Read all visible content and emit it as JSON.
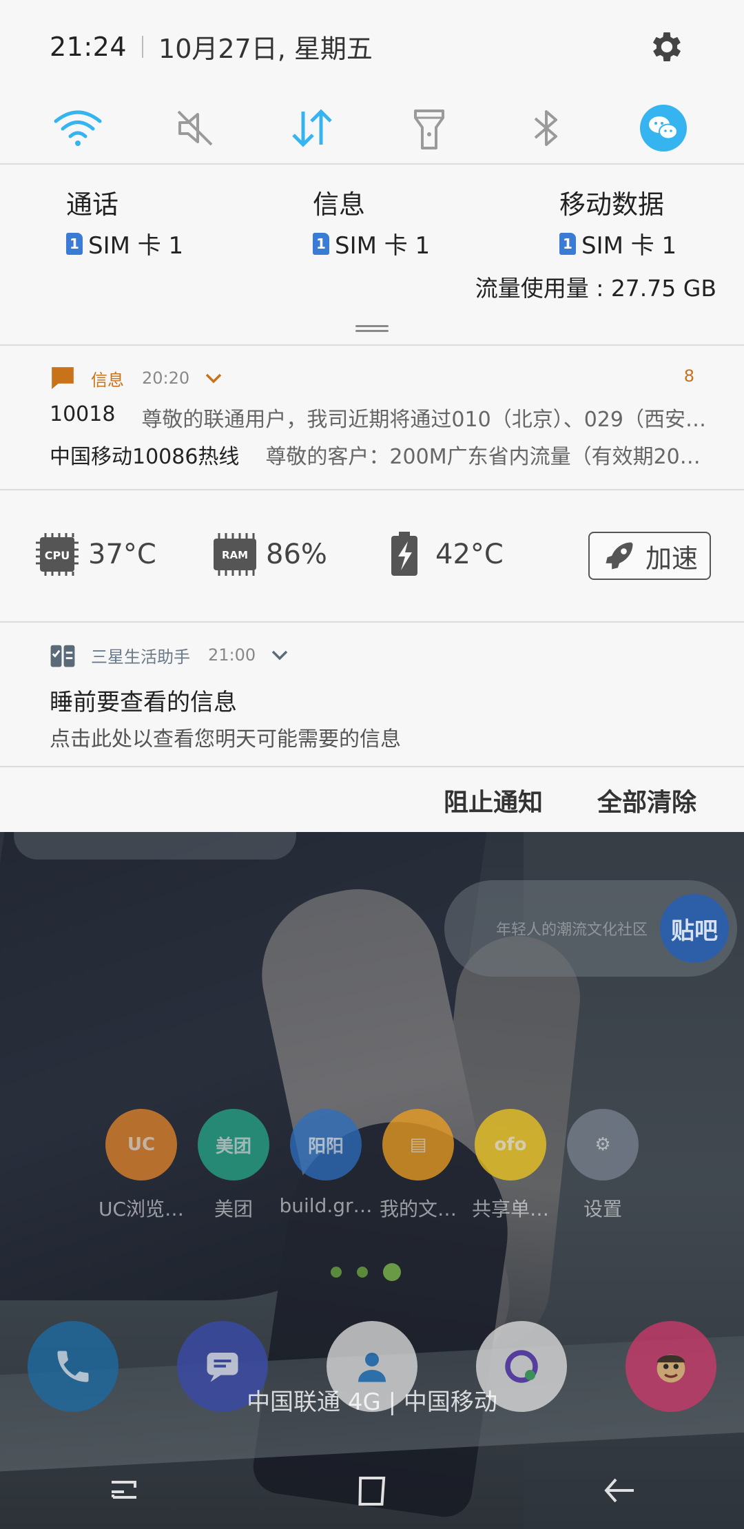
{
  "status_bar": {
    "time": "21:24",
    "date": "10月27日, 星期五"
  },
  "quick_settings": [
    {
      "name": "wifi",
      "icon": "wifi-icon",
      "active": true
    },
    {
      "name": "sound",
      "icon": "mute-icon",
      "active": false
    },
    {
      "name": "mobile-data",
      "icon": "data-arrows-icon",
      "active": true
    },
    {
      "name": "flashlight",
      "icon": "flashlight-icon",
      "active": false
    },
    {
      "name": "bluetooth",
      "icon": "bluetooth-icon",
      "active": false
    },
    {
      "name": "wechat",
      "icon": "wechat-icon",
      "active": true
    }
  ],
  "sim_settings": {
    "call": {
      "title": "通话",
      "sim": "SIM 卡 1",
      "slot": "1"
    },
    "message": {
      "title": "信息",
      "sim": "SIM 卡 1",
      "slot": "1"
    },
    "mobile_data": {
      "title": "移动数据",
      "sim": "SIM 卡 1",
      "slot": "1"
    },
    "data_usage": "流量使用量 : 27.75 GB"
  },
  "messages_notification": {
    "app": "信息",
    "time": "20:20",
    "count": "8",
    "items": [
      {
        "sender": "10018",
        "body": "尊敬的联通用户，我司近期将通过010（北京）、029（西安…"
      },
      {
        "sender": "中国移动10086热线",
        "body": "尊敬的客户：200M广东省内流量（有效期20天…"
      }
    ]
  },
  "device_stats": {
    "cpu_temp": "37°C",
    "ram": "86%",
    "battery_temp": "42°C",
    "boost_label": "加速",
    "cpu_icon_text": "CPU",
    "ram_icon_text": "RAM"
  },
  "assistant_notification": {
    "app": "三星生活助手",
    "time": "21:00",
    "title": "睡前要查看的信息",
    "body": "点击此处以查看您明天可能需要的信息"
  },
  "actions": {
    "block": "阻止通知",
    "clear_all": "全部清除"
  },
  "home_screen": {
    "tieba_slogan": "年轻人的潮流文化社区",
    "tieba_logo": "贴吧",
    "apps": [
      {
        "label": "UC浏览…",
        "color": "#e8862a",
        "glyph": "UC"
      },
      {
        "label": "美团",
        "color": "#26a98a",
        "glyph": "美团"
      },
      {
        "label": "build.gr…",
        "color": "#2d6fc0",
        "glyph": "阳阳"
      },
      {
        "label": "我的文…",
        "color": "#f0a020",
        "glyph": "▤"
      },
      {
        "label": "共享单…",
        "color": "#f2c81e",
        "glyph": "ofo"
      },
      {
        "label": "设置",
        "color": "#7a8290",
        "glyph": "⚙"
      }
    ],
    "carrier": "中国联通 4G | 中国移动"
  },
  "colors": {
    "accent_blue": "#35b4f0",
    "icon_grey": "#9a9a9a",
    "message_orange": "#c8721a",
    "sim_badge": "#3a7bd5"
  }
}
